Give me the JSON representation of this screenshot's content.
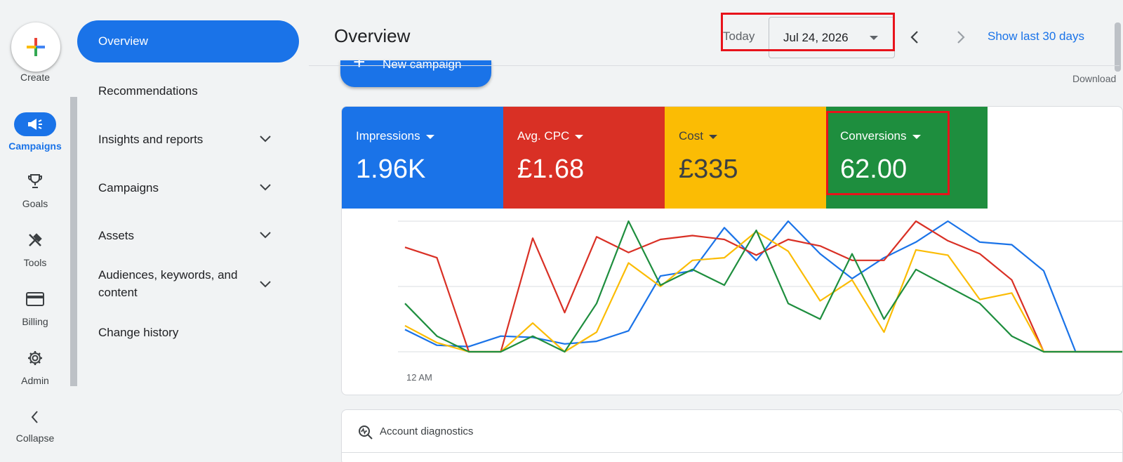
{
  "rail": {
    "create_label": "Create",
    "items": [
      {
        "label": "Campaigns",
        "icon": "megaphone-icon",
        "active": true
      },
      {
        "label": "Goals",
        "icon": "trophy-icon"
      },
      {
        "label": "Tools",
        "icon": "tools-icon"
      },
      {
        "label": "Billing",
        "icon": "credit-card-icon"
      },
      {
        "label": "Admin",
        "icon": "gear-icon"
      },
      {
        "label": "Collapse",
        "icon": "chevron-left-icon"
      }
    ]
  },
  "nav": {
    "items": [
      {
        "label": "Overview",
        "active": true
      },
      {
        "label": "Recommendations"
      },
      {
        "label": "Insights and reports",
        "expandable": true
      },
      {
        "label": "Campaigns",
        "expandable": true
      },
      {
        "label": "Assets",
        "expandable": true
      },
      {
        "label": "Audiences, keywords, and content",
        "expandable": true
      },
      {
        "label": "Change history"
      }
    ]
  },
  "header": {
    "title": "Overview",
    "today_label": "Today",
    "date_value": "Jul 24, 2026",
    "show_last_label": "Show last 30 days",
    "new_campaign_label": "New campaign",
    "download_label": "Download"
  },
  "metrics": [
    {
      "name": "Impressions",
      "value": "1.96K",
      "bg": "#1a73e8",
      "fg": "#ffffff"
    },
    {
      "name": "Avg. CPC",
      "value": "£1.68",
      "bg": "#d93025",
      "fg": "#ffffff"
    },
    {
      "name": "Cost",
      "value": "£335",
      "bg": "#fbbc04",
      "fg": "#3c4043"
    },
    {
      "name": "Conversions",
      "value": "62.00",
      "bg": "#1e8e3e",
      "fg": "#ffffff"
    }
  ],
  "chart_data": {
    "type": "line",
    "x_first_label": "12 AM",
    "ylim": [
      0,
      100
    ],
    "grid": true,
    "series": [
      {
        "color": "#1a73e8",
        "values": [
          17,
          5,
          4,
          12,
          11,
          6,
          8,
          16,
          58,
          62,
          95,
          70,
          100,
          75,
          56,
          72,
          84,
          100,
          84,
          82,
          62,
          0,
          0,
          0
        ]
      },
      {
        "color": "#d93025",
        "values": [
          80,
          72,
          0,
          0,
          87,
          30,
          88,
          76,
          86,
          89,
          86,
          74,
          86,
          81,
          70,
          70,
          100,
          85,
          75,
          55,
          0,
          0,
          0,
          0
        ]
      },
      {
        "color": "#fbbc04",
        "values": [
          20,
          7,
          0,
          0,
          22,
          0,
          15,
          68,
          50,
          70,
          72,
          92,
          77,
          39,
          55,
          15,
          78,
          74,
          40,
          45,
          0,
          0,
          0,
          0
        ]
      },
      {
        "color": "#1e8e3e",
        "values": [
          37,
          12,
          0,
          0,
          12,
          0,
          37,
          100,
          51,
          63,
          51,
          93,
          37,
          25,
          75,
          25,
          63,
          50,
          37,
          12,
          0,
          0,
          0,
          0
        ]
      }
    ]
  },
  "diagnostics": {
    "label": "Account diagnostics"
  }
}
